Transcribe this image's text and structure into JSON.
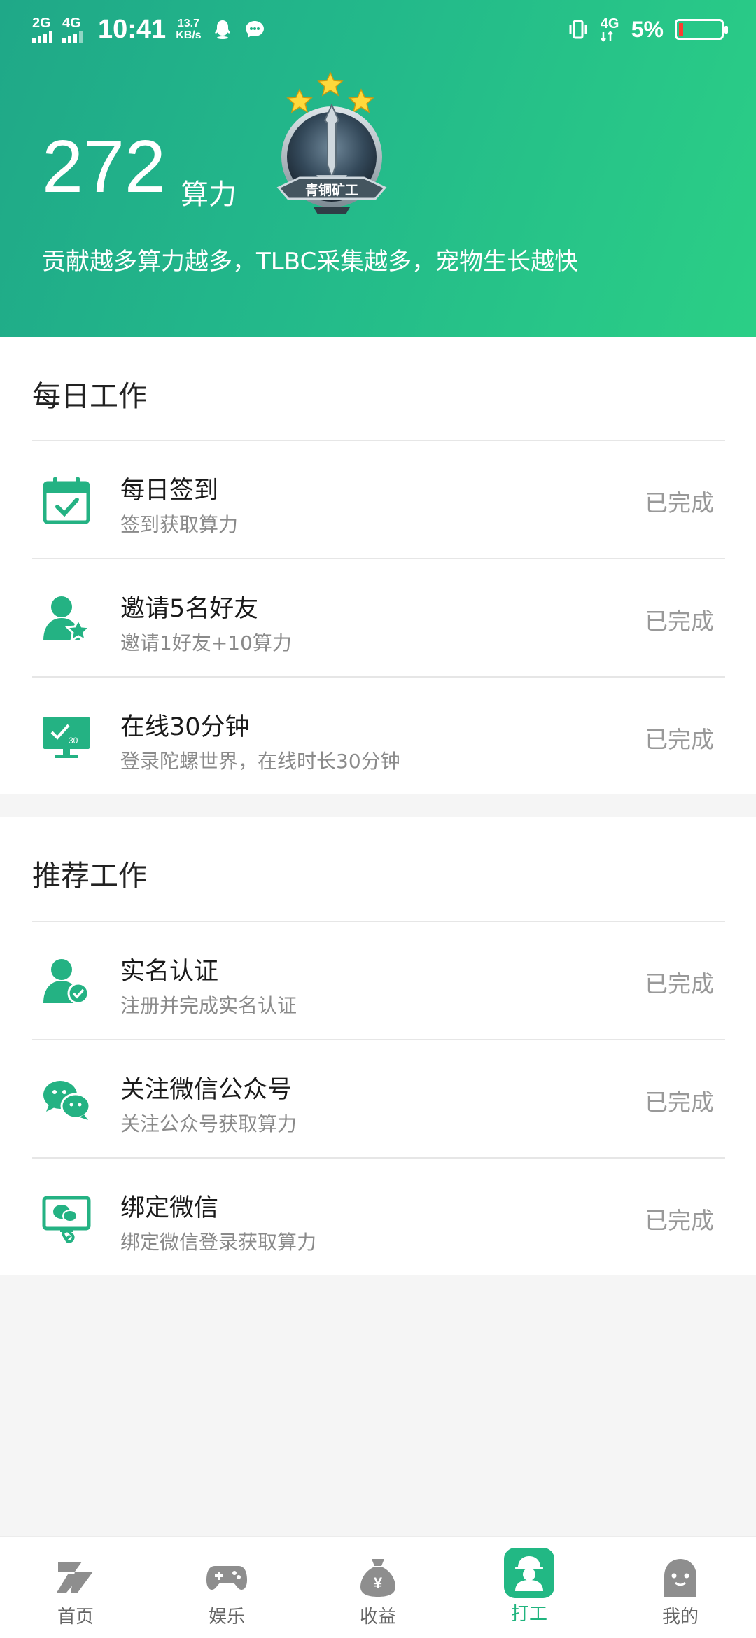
{
  "status_bar": {
    "signal1": "2G",
    "signal2": "4G",
    "time": "10:41",
    "speed_value": "13.7",
    "speed_unit": "KB/s",
    "network": "4G",
    "battery_percent": "5%"
  },
  "hero": {
    "power_value": "272",
    "power_unit": "算力",
    "badge_label": "青铜矿工",
    "badge_stars": 3,
    "subtitle": "贡献越多算力越多，TLBC采集越多，宠物生长越快"
  },
  "daily": {
    "title": "每日工作",
    "tasks": [
      {
        "title": "每日签到",
        "subtitle": "签到获取算力",
        "status": "已完成",
        "icon": "calendar-check-icon"
      },
      {
        "title": "邀请5名好友",
        "subtitle": "邀请1好友+10算力",
        "status": "已完成",
        "icon": "user-star-icon"
      },
      {
        "title": "在线30分钟",
        "subtitle": "登录陀螺世界，在线时长30分钟",
        "status": "已完成",
        "icon": "monitor-timer-icon"
      }
    ]
  },
  "recommended": {
    "title": "推荐工作",
    "tasks": [
      {
        "title": "实名认证",
        "subtitle": "注册并完成实名认证",
        "status": "已完成",
        "icon": "user-verified-icon"
      },
      {
        "title": "关注微信公众号",
        "subtitle": "关注公众号获取算力",
        "status": "已完成",
        "icon": "wechat-icon"
      },
      {
        "title": "绑定微信",
        "subtitle": "绑定微信登录获取算力",
        "status": "已完成",
        "icon": "wechat-link-icon"
      }
    ]
  },
  "tabbar": {
    "tabs": [
      {
        "label": "首页",
        "icon": "home-logo-icon"
      },
      {
        "label": "娱乐",
        "icon": "gamepad-icon"
      },
      {
        "label": "收益",
        "icon": "money-bag-icon"
      },
      {
        "label": "打工",
        "icon": "worker-icon",
        "active": true
      },
      {
        "label": "我的",
        "icon": "profile-face-icon"
      }
    ]
  },
  "colors": {
    "accent": "#20b47e",
    "hero_start": "#1fa888",
    "hero_end": "#2bcf86",
    "status_done": "#999999"
  }
}
